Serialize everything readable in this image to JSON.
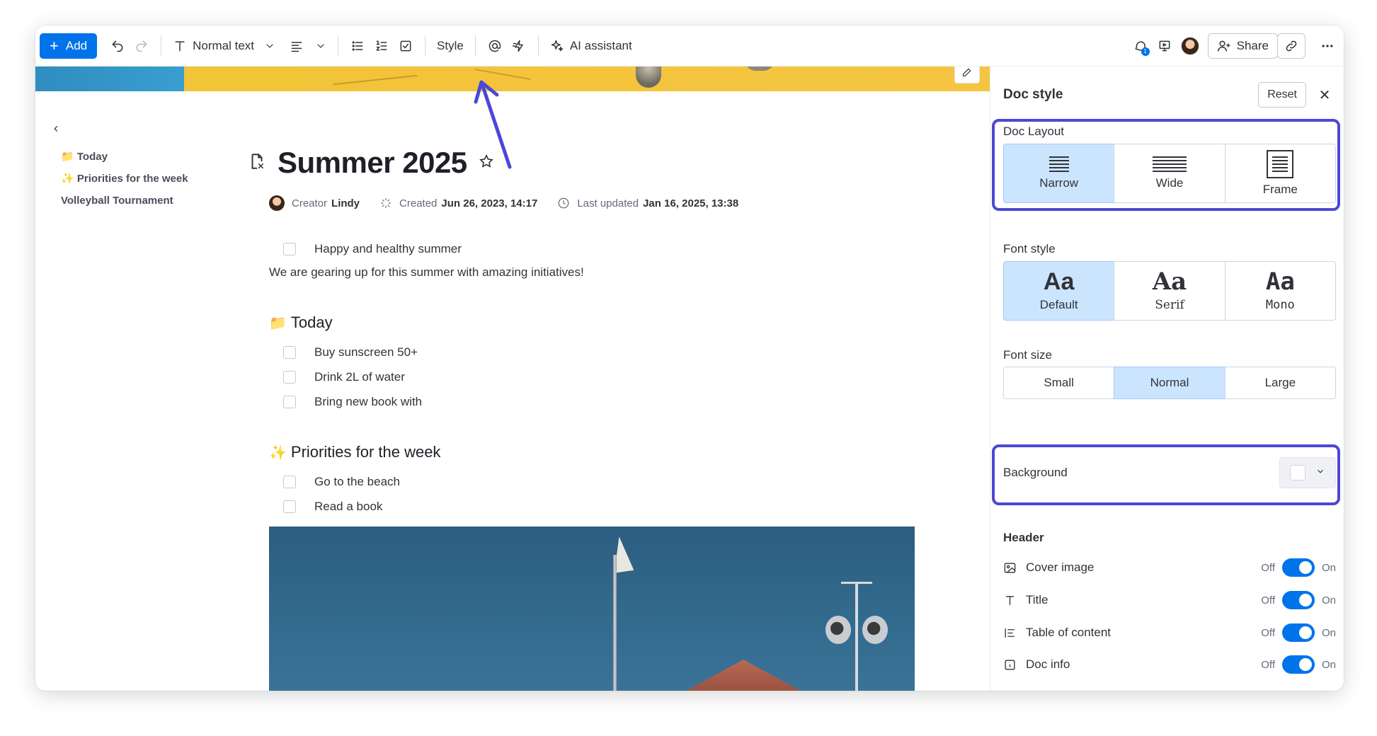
{
  "toolbar": {
    "add_label": "Add",
    "text_style": "Normal text",
    "style_label": "Style",
    "ai_label": "AI assistant",
    "share_label": "Share",
    "notif_count": "1"
  },
  "toc": {
    "items": [
      {
        "emoji": "📁",
        "label": "Today"
      },
      {
        "emoji": "✨",
        "label": "Priorities for the week"
      },
      {
        "emoji": "",
        "label": "Volleyball Tournament"
      }
    ]
  },
  "doc": {
    "title": "Summer 2025",
    "meta": {
      "creator_prefix": "Creator",
      "creator_name": "Lindy",
      "created_prefix": "Created",
      "created_value": "Jun 26, 2023, 14:17",
      "updated_prefix": "Last updated",
      "updated_value": "Jan 16, 2025, 13:38"
    },
    "top_check": "Happy and healthy summer",
    "intro": "We are gearing up for this summer with amazing initiatives!",
    "section1": {
      "emoji": "📁",
      "title": "Today",
      "items": [
        "Buy sunscreen 50+",
        "Drink 2L of water",
        "Bring new book with"
      ]
    },
    "section2": {
      "emoji": "✨",
      "title": "Priorities for the week",
      "items": [
        "Go to the beach",
        "Read a book"
      ]
    }
  },
  "panel": {
    "title": "Doc style",
    "reset_label": "Reset",
    "close_glyph": "✕",
    "layout": {
      "label": "Doc Layout",
      "options": [
        "Narrow",
        "Wide",
        "Frame"
      ],
      "selected": "Narrow"
    },
    "font_style": {
      "label": "Font style",
      "sample": "Aa",
      "options": [
        "Default",
        "Serif",
        "Mono"
      ],
      "selected": "Default"
    },
    "font_size": {
      "label": "Font size",
      "options": [
        "Small",
        "Normal",
        "Large"
      ],
      "selected": "Normal"
    },
    "background": {
      "label": "Background",
      "swatch_color": "#ffffff"
    },
    "header": {
      "label": "Header",
      "off_label": "Off",
      "on_label": "On",
      "rows": [
        {
          "icon": "image-icon",
          "label": "Cover image",
          "state": "on"
        },
        {
          "icon": "text-icon",
          "label": "Title",
          "state": "on"
        },
        {
          "icon": "list-icon",
          "label": "Table of content",
          "state": "on"
        },
        {
          "icon": "info-icon",
          "label": "Doc info",
          "state": "on"
        }
      ]
    }
  },
  "colors": {
    "primary": "#0073ea",
    "selected_bg": "#cce5ff",
    "annotation": "#4b48d6"
  }
}
